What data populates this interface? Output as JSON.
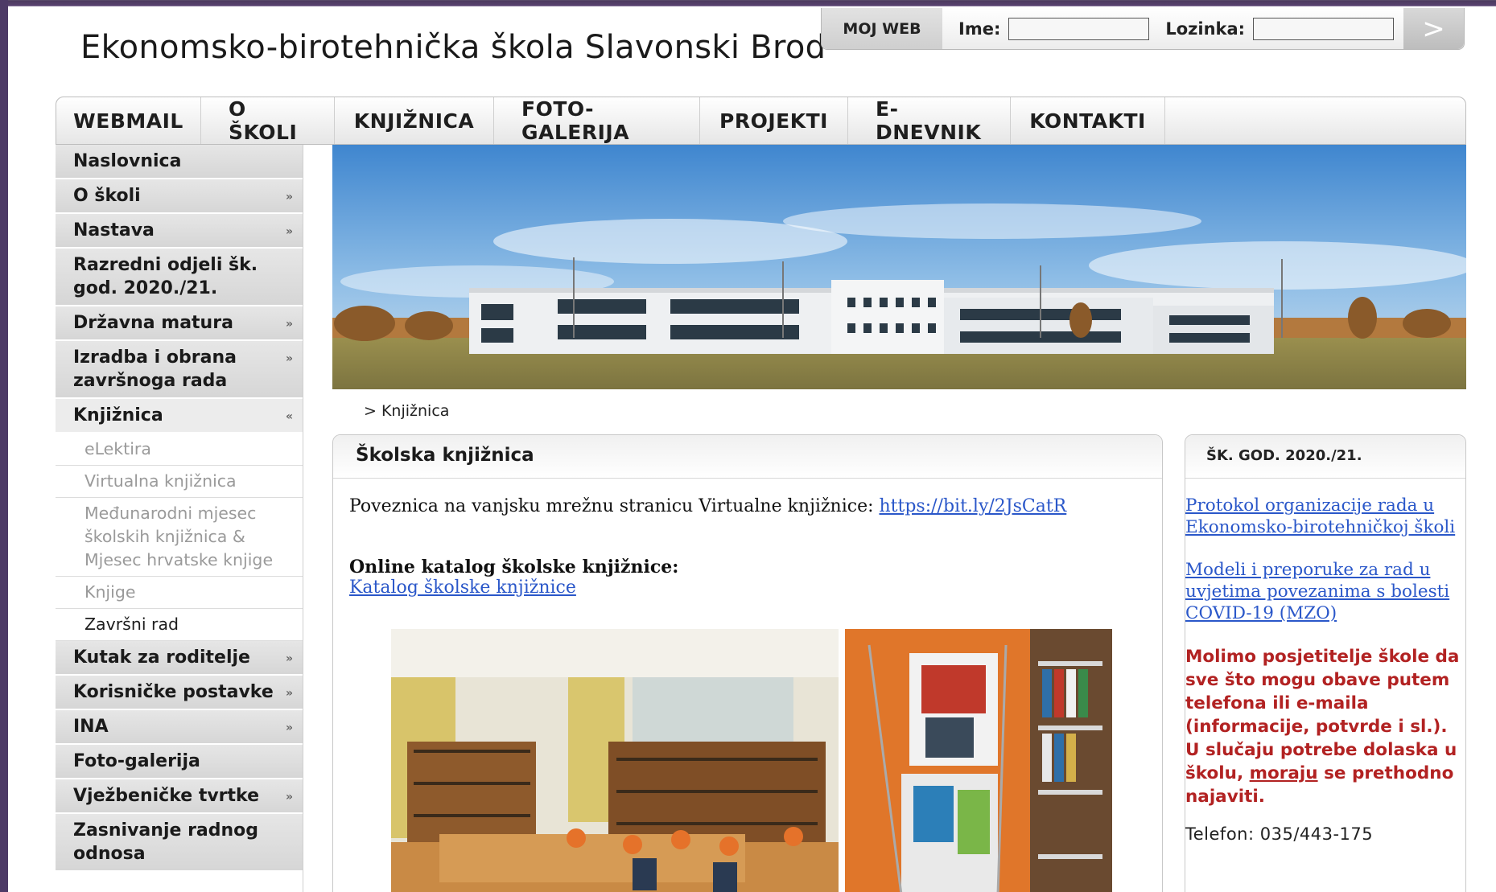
{
  "site_title": "Ekonomsko-birotehnička škola Slavonski Brod",
  "login": {
    "moj_web": "MOJ WEB",
    "user_label": "Ime:",
    "pass_label": "Lozinka:",
    "submit": ">"
  },
  "nav": [
    "WEBMAIL",
    "O ŠKOLI",
    "KNJIŽNICA",
    "FOTO-GALERIJA",
    "PROJEKTI",
    "E-DNEVNIK",
    "KONTAKTI"
  ],
  "sidebar": {
    "items": [
      {
        "label": "Naslovnica",
        "arrow": ""
      },
      {
        "label": "O školi",
        "arrow": "»"
      },
      {
        "label": "Nastava",
        "arrow": "»"
      },
      {
        "label": "Razredni odjeli šk. god. 2020./21.",
        "arrow": ""
      },
      {
        "label": "Državna matura",
        "arrow": "»"
      },
      {
        "label": "Izradba i obrana završnoga rada",
        "arrow": "»"
      },
      {
        "label": "Knjižnica",
        "arrow": "«"
      }
    ],
    "sub_items": [
      "eLektira",
      "Virtualna knjižnica",
      "Međunarodni mjesec školskih knjižnica & Mjesec hrvatske knjige",
      "Knjige",
      "Završni rad"
    ],
    "items_after": [
      {
        "label": "Kutak za roditelje",
        "arrow": "»"
      },
      {
        "label": "Korisničke postavke",
        "arrow": "»"
      },
      {
        "label": "INA",
        "arrow": "»"
      },
      {
        "label": "Foto-galerija",
        "arrow": ""
      },
      {
        "label": "Vježbeničke tvrtke",
        "arrow": "»"
      },
      {
        "label": "Zasnivanje radnog odnosa",
        "arrow": ""
      }
    ]
  },
  "breadcrumb": "> Knjižnica",
  "main": {
    "title": "Školska knjižnica",
    "intro": "Poveznica na vanjsku mrežnu stranicu Virtualne knjižnice: ",
    "intro_link": "https://bit.ly/2JsCatR",
    "katalog_title": "Online katalog školske knjižnice:",
    "katalog_link": "Katalog školske knjižnice"
  },
  "right": {
    "title": "ŠK. GOD. 2020./21.",
    "links": [
      "Protokol organizacije rada u Ekonomsko-birotehničkoj školi",
      "Modeli i preporuke za rad u uvjetima povezanima s bolesti COVID-19 (MZO)"
    ],
    "notice_before": "Molimo posjetitelje škole da sve što mogu obave putem telefona ili e-maila (informacije, potvrde i sl.). U slučaju potrebe dolaska u školu, ",
    "notice_underlined": "moraju",
    "notice_after": " se prethodno najaviti.",
    "phone": "Telefon: 035/443-175"
  }
}
